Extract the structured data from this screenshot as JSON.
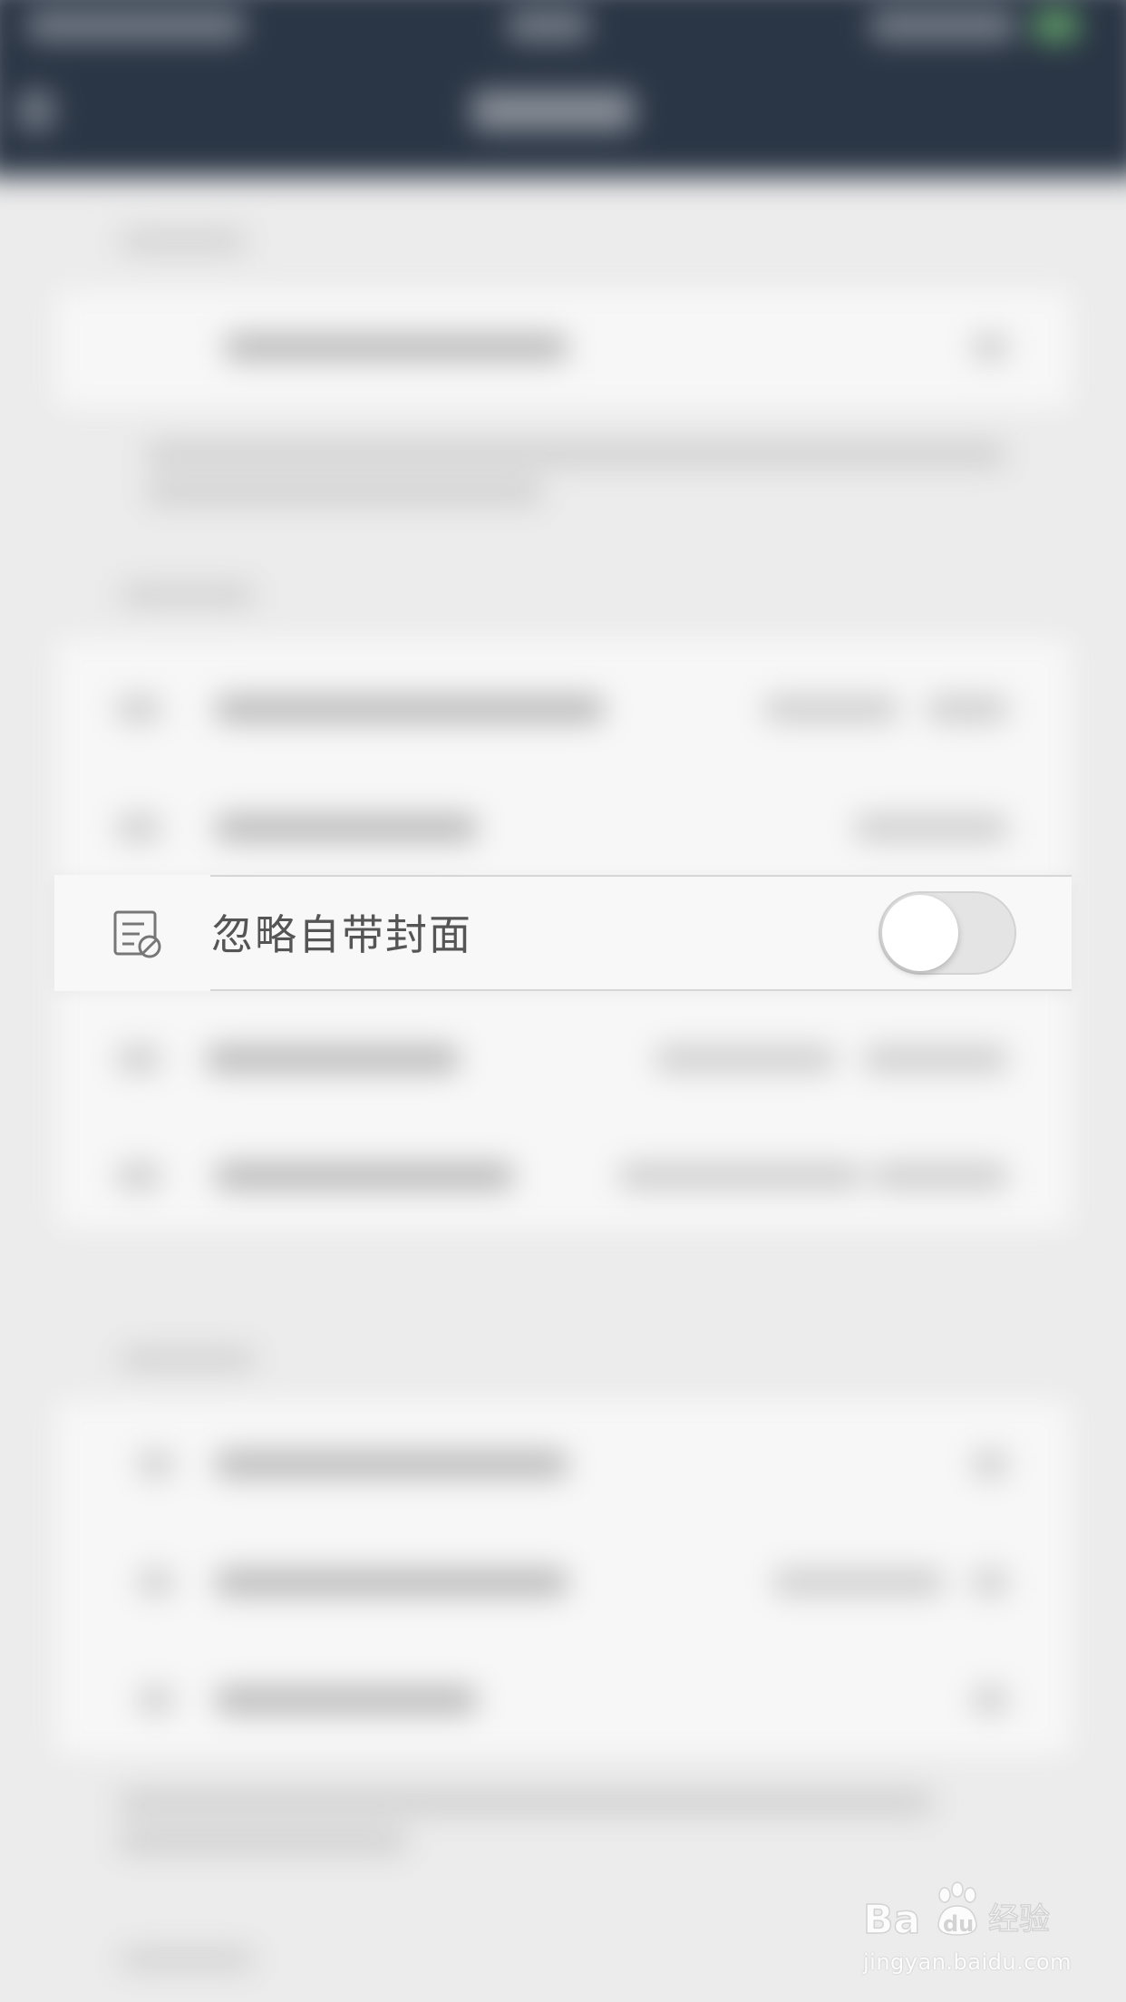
{
  "settings_row": {
    "label": "忽略自带封面",
    "icon": "cover-ignore-icon",
    "toggle_on": false
  },
  "watermark": {
    "brand": "Baidu经验",
    "url": "jingyan.baidu.com"
  },
  "colors": {
    "top_bar": "#2a3545",
    "background": "#ececec",
    "row_background": "#f8f8f8",
    "label_text": "#555555",
    "toggle_track_off": "#e4e4e4"
  }
}
